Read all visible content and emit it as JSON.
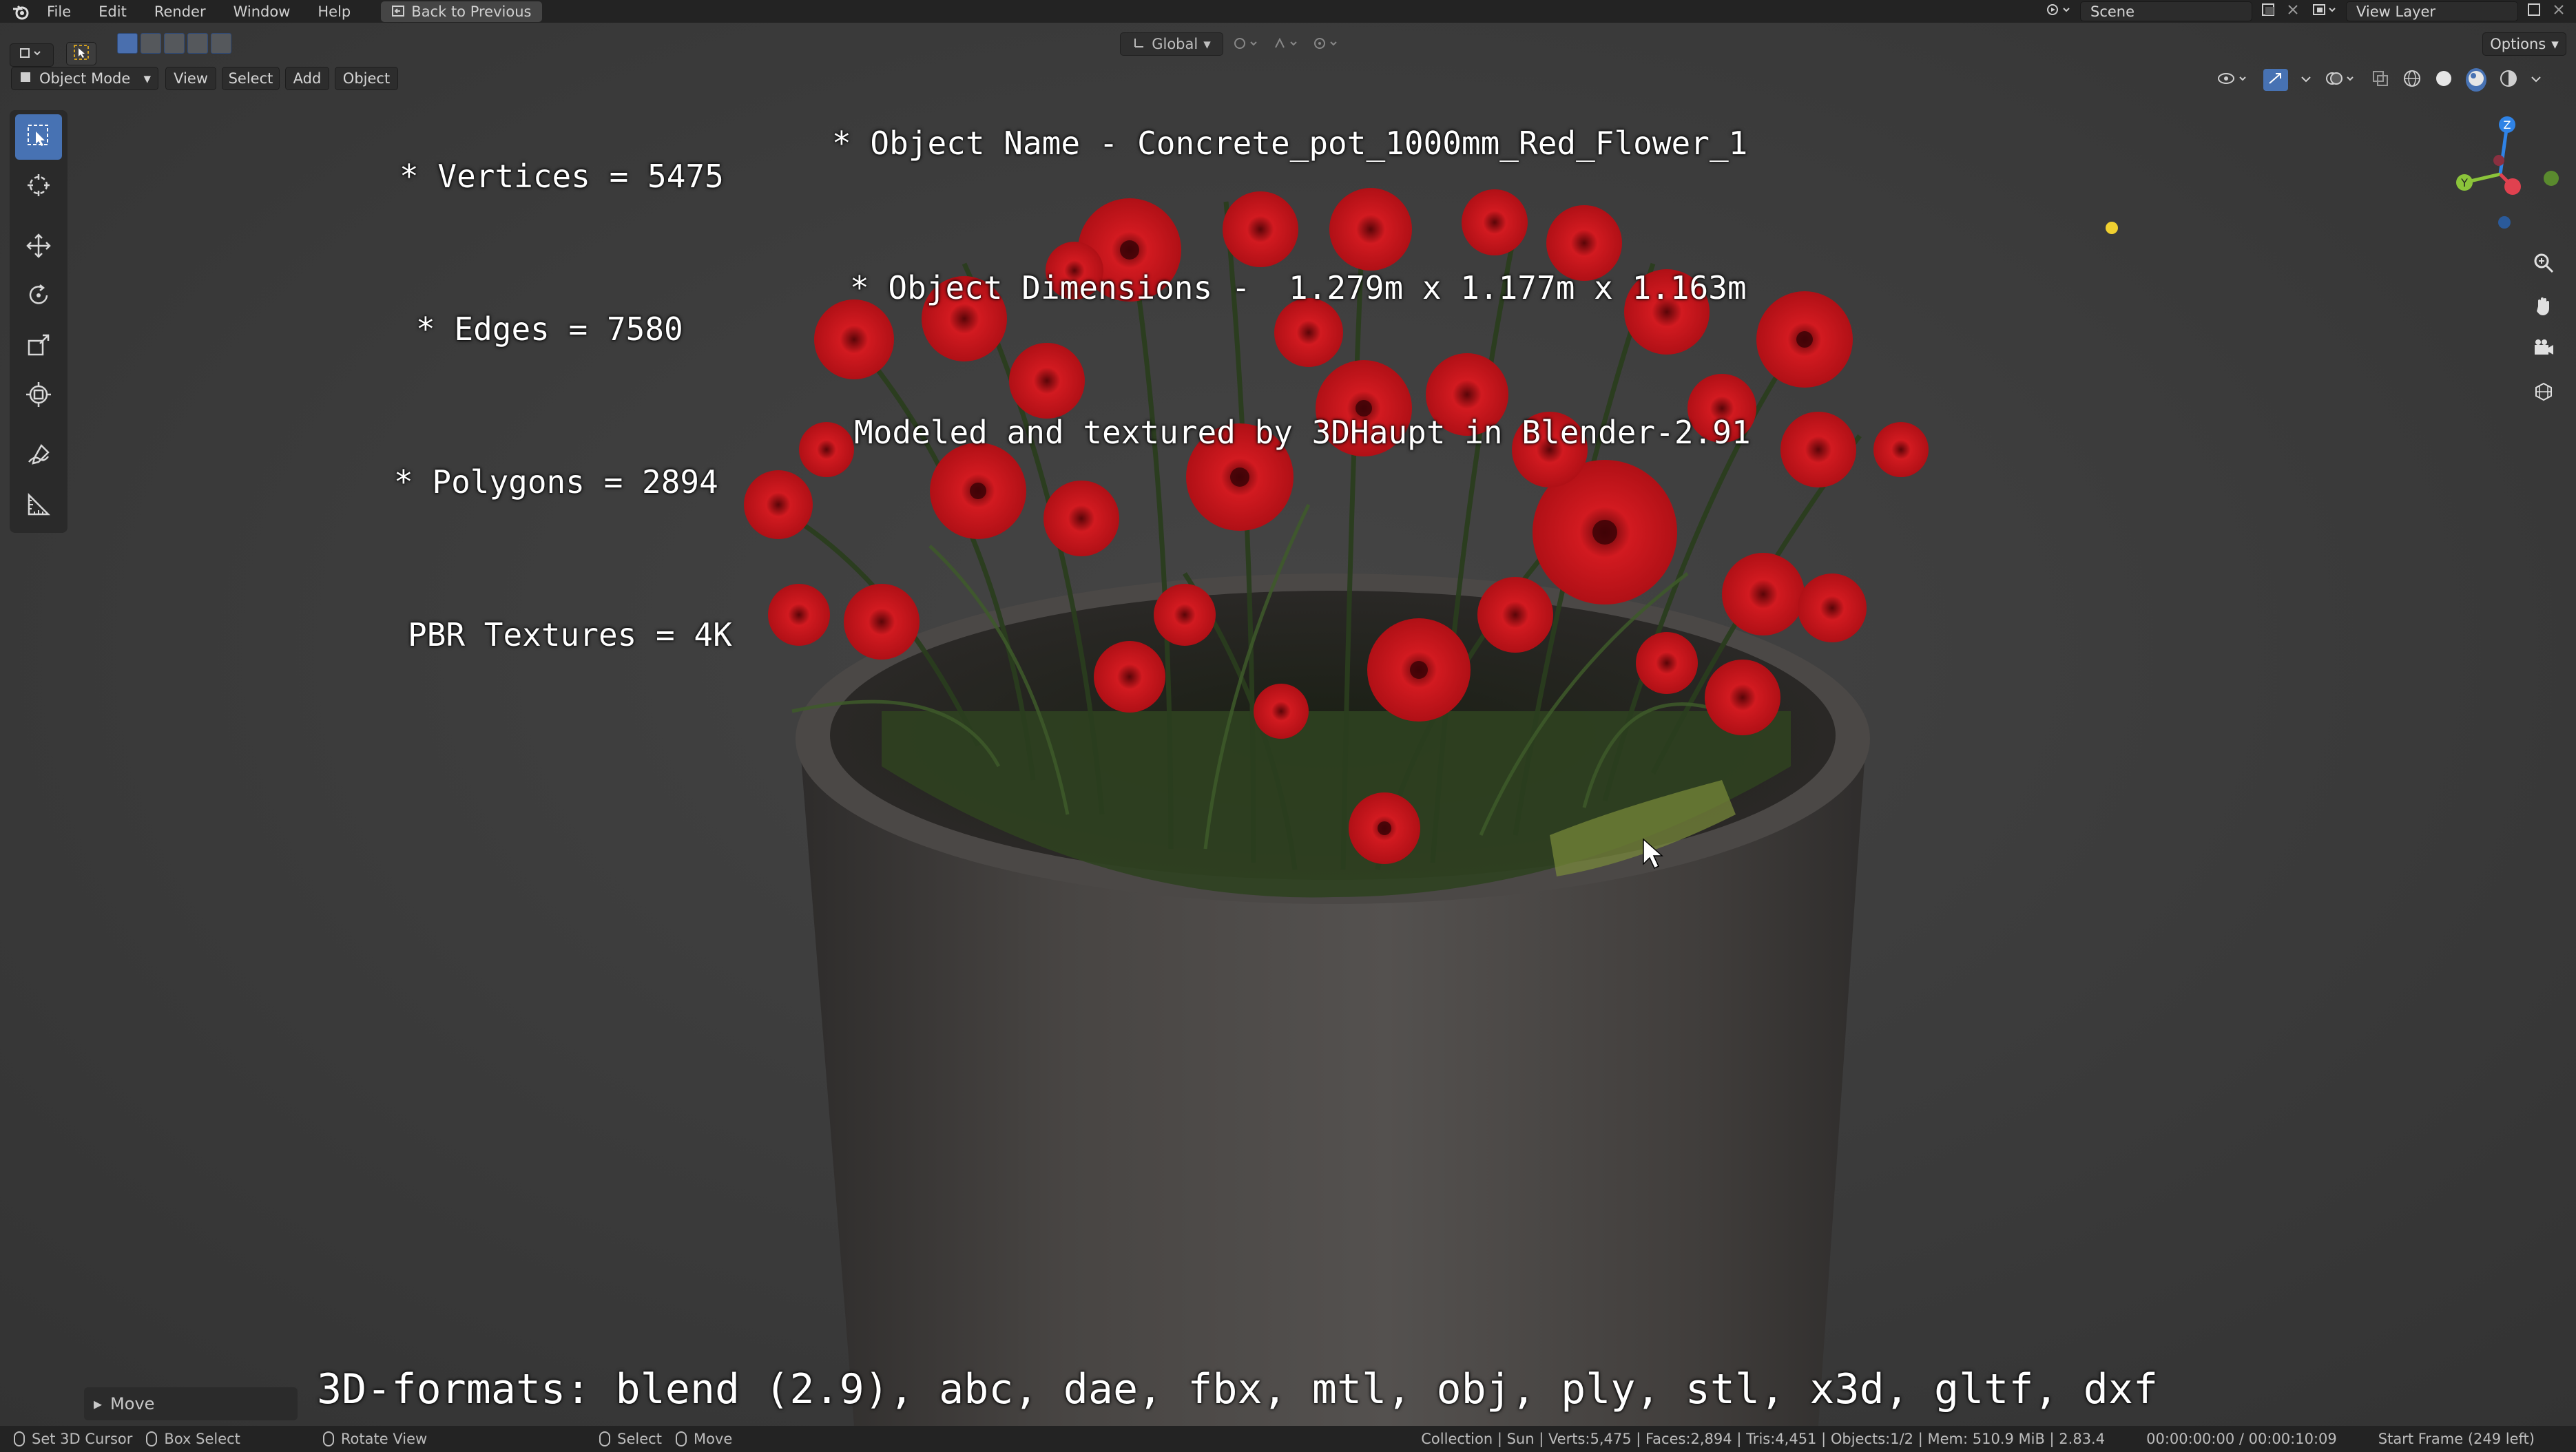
{
  "topbar": {
    "menu": [
      "File",
      "Edit",
      "Render",
      "Window",
      "Help"
    ],
    "back_label": "Back to Previous",
    "scene_label": "Scene",
    "view_layer_label": "View Layer"
  },
  "header": {
    "mode_label": "Object Mode",
    "menus": [
      "View",
      "Select",
      "Add",
      "Object"
    ],
    "transform_orientation": "Global",
    "options_label": "Options"
  },
  "overlay": {
    "stats": [
      "* Vertices = 5475",
      "* Edges = 7580",
      "* Polygons = 2894",
      "PBR Textures = 4K"
    ],
    "object_info": [
      "* Object Name - Concrete_pot_1000mm_Red_Flower_1",
      "* Object Dimensions -  1.279m x 1.177m x 1.163m",
      "Modeled and textured by 3DHaupt in Blender-2.91"
    ],
    "formats": "3D-formats: blend (2.9), abc, dae, fbx, mtl, obj, ply, stl, x3d, gltf, dxf"
  },
  "last_operation": {
    "label": "Move"
  },
  "statusbar": {
    "hints": [
      {
        "label": "Set 3D Cursor"
      },
      {
        "label": "Box Select"
      },
      {
        "label": "Rotate View"
      },
      {
        "label": "Select"
      },
      {
        "label": "Move"
      }
    ],
    "scene_stats": "Collection | Sun | Verts:5,475 | Faces:2,894 | Tris:4,451 | Objects:1/2 | Mem: 510.9 MiB | 2.83.4",
    "timecode": "00:00:00:00 / 00:00:10:09",
    "start_frame": "Start Frame (249 left)"
  },
  "colors": {
    "accent": "#4772b3",
    "axis_x": "#e0414f",
    "axis_y": "#8bc43a",
    "axis_z": "#2f83e6",
    "flower": "#c8141a",
    "pot": "#4a4745"
  },
  "icons": {
    "toolbar": [
      "select-box-icon",
      "cursor-icon",
      "move-icon",
      "rotate-icon",
      "scale-icon",
      "transform-icon",
      "annotate-icon",
      "measure-icon"
    ],
    "navigation": [
      "zoom-icon",
      "pan-hand-icon",
      "camera-icon",
      "ortho-grid-icon"
    ]
  }
}
